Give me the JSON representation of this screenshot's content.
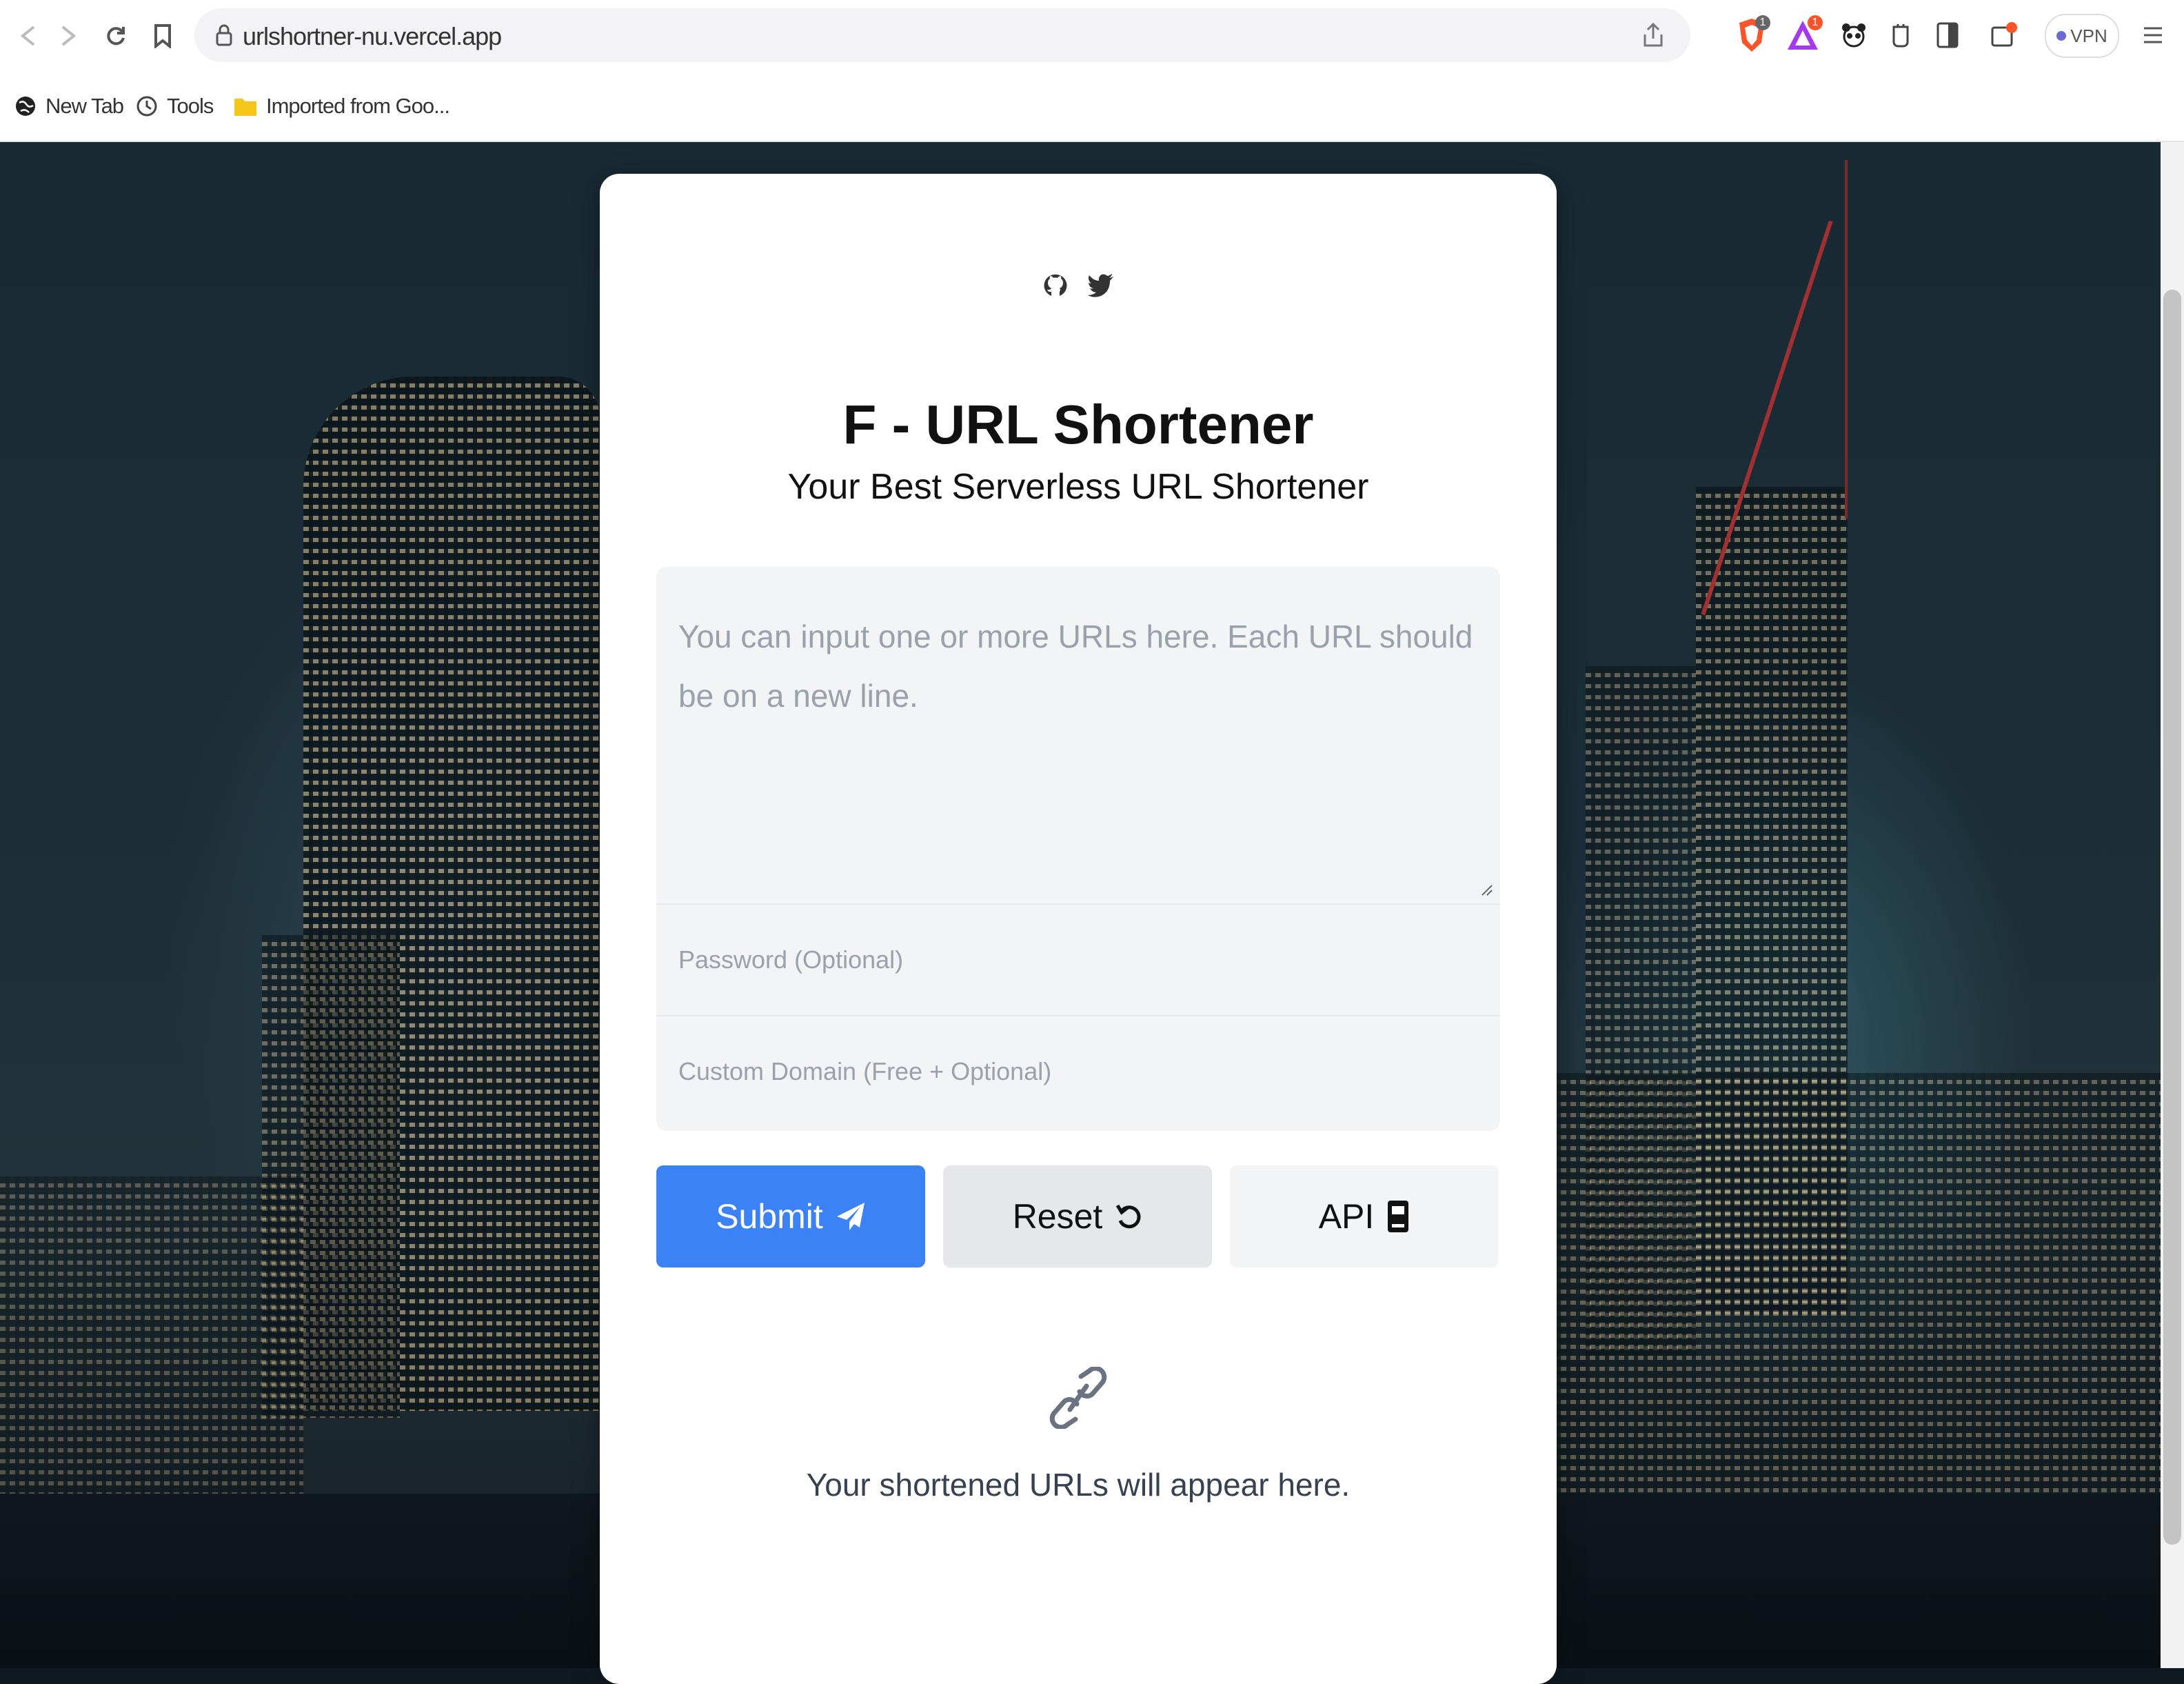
{
  "browser": {
    "url": "urlshortner-nu.vercel.app",
    "vpn_label": "VPN",
    "bookmarks": [
      {
        "label": "New Tab",
        "icon": "globe-icon"
      },
      {
        "label": "Tools",
        "icon": "clock-icon"
      },
      {
        "label": "Imported from Goo...",
        "icon": "folder-icon"
      }
    ],
    "extension_badges": {
      "brave": "1",
      "rewards": "1"
    }
  },
  "card": {
    "social_icons": [
      "github-icon",
      "twitter-icon"
    ],
    "title": "F - URL Shortener",
    "subtitle": "Your Best Serverless URL Shortener",
    "urls_input": {
      "value": "",
      "placeholder": "You can input one or more URLs here. Each URL should be on a new line."
    },
    "password_input": {
      "value": "",
      "placeholder": "Password (Optional)"
    },
    "domain_input": {
      "value": "",
      "placeholder": "Custom Domain (Free + Optional)"
    },
    "buttons": {
      "submit": "Submit",
      "reset": "Reset",
      "api": "API"
    },
    "result_placeholder": "Your shortened URLs will appear here."
  },
  "colors": {
    "primary": "#3b82f6",
    "reset_bg": "#e5e7eb",
    "api_bg": "#f3f4f6",
    "form_bg": "#f3f4f6",
    "ext_orange": "#fb542b"
  }
}
